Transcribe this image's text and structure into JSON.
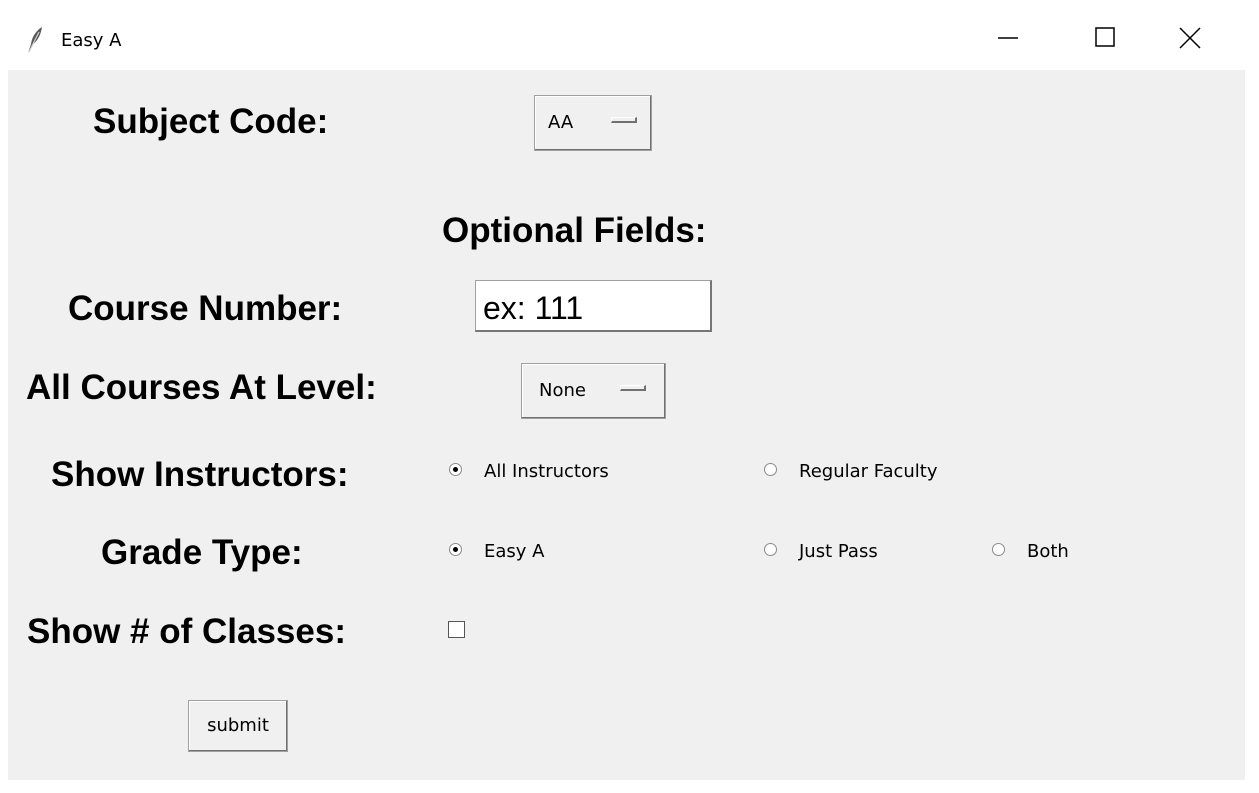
{
  "window": {
    "title": "Easy A",
    "icon": "feather-icon",
    "controls": [
      "minimize-icon",
      "maximize-icon",
      "close-icon"
    ]
  },
  "form": {
    "subject_code_label": "Subject Code:",
    "subject_code_value": "AA",
    "optional_fields_label": "Optional Fields:",
    "course_number_label": "Course Number:",
    "course_number_value": "ex: 111",
    "level_label": "All Courses At Level:",
    "level_value": "None",
    "instructors_label": "Show Instructors:",
    "instructors_options": [
      {
        "label": "All Instructors",
        "selected": true
      },
      {
        "label": "Regular Faculty",
        "selected": false
      }
    ],
    "grade_type_label": "Grade Type:",
    "grade_type_options": [
      {
        "label": "Easy A",
        "selected": true
      },
      {
        "label": "Just Pass",
        "selected": false
      },
      {
        "label": "Both",
        "selected": false
      }
    ],
    "show_classes_label": "Show # of Classes:",
    "show_classes_checked": false,
    "submit_label": "submit"
  }
}
